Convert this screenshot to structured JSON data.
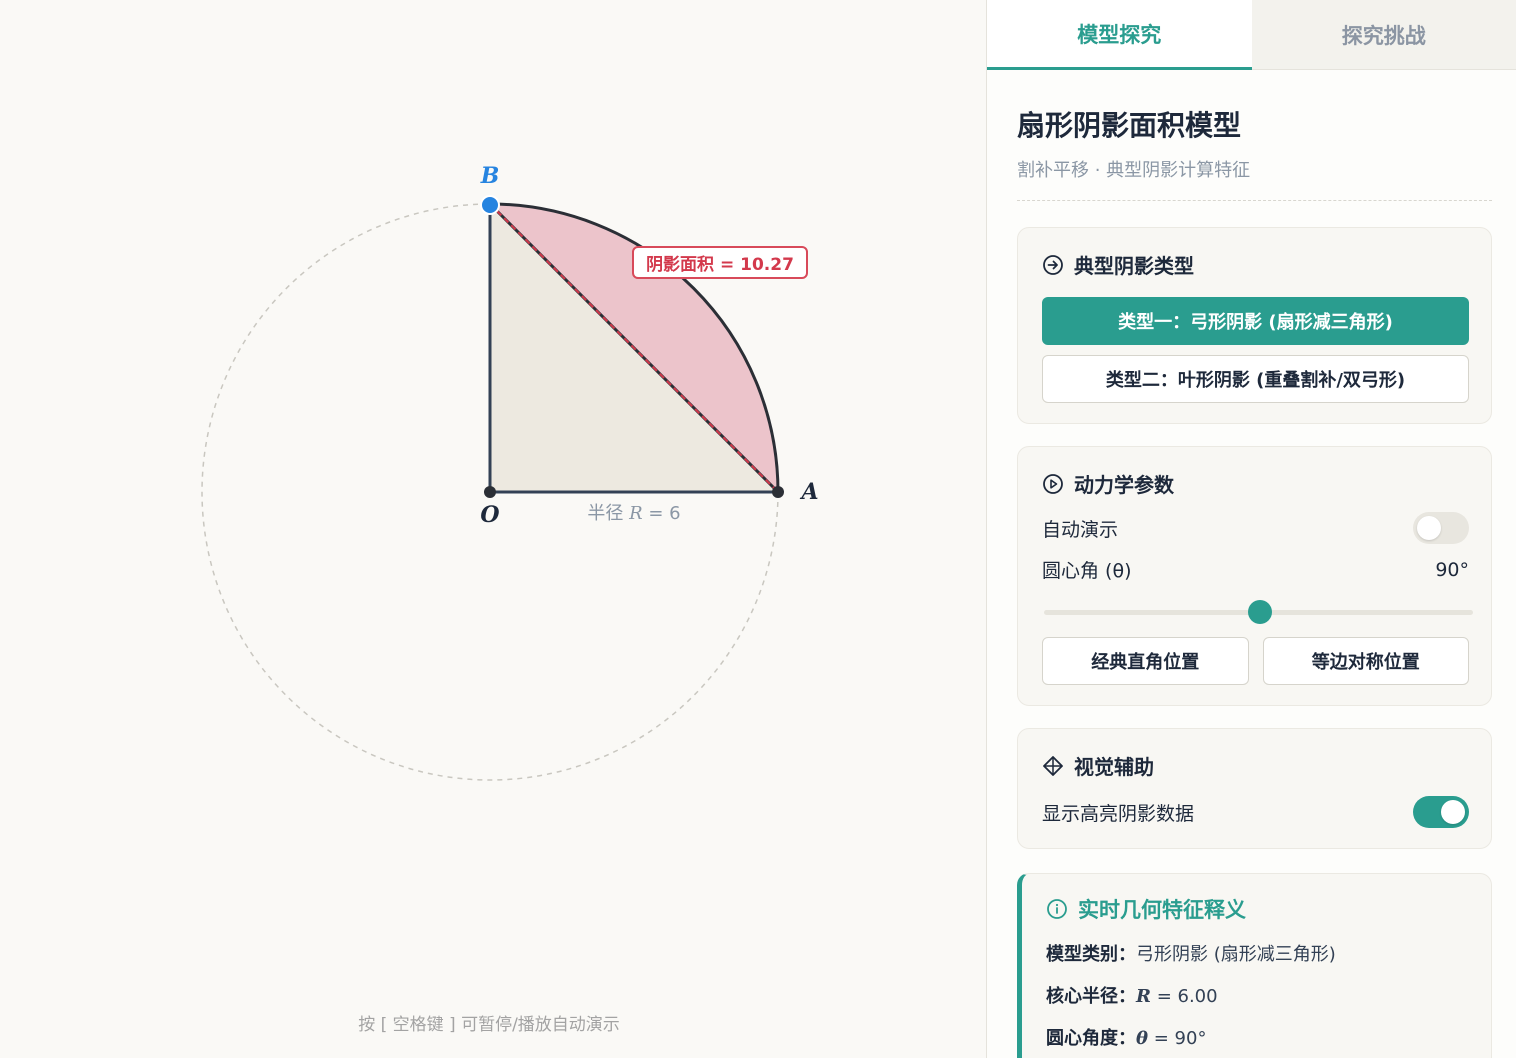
{
  "canvas": {
    "label_B": "B",
    "label_A": "A",
    "label_O": "O",
    "radius_label_prefix": "半径 ",
    "radius_label_var": "R",
    "radius_label_suffix": " = 6",
    "shaded_area_label": "阴影面积 = 10.27",
    "hint": "按 [ 空格键 ] 可暂停/播放自动演示",
    "colors": {
      "shade": "#ecc4cb",
      "sector": "#ede9e0",
      "point_B": "#2684e0",
      "chord": "#d3394c"
    }
  },
  "tabs": [
    {
      "label": "模型探究",
      "active": true
    },
    {
      "label": "探究挑战",
      "active": false
    }
  ],
  "panel": {
    "title": "扇形阴影面积模型",
    "subtitle": "割补平移 · 典型阴影计算特征"
  },
  "types_card": {
    "heading": "典型阴影类型",
    "icon": "arrow-circle-icon",
    "type1": "类型一：弓形阴影 (扇形减三角形)",
    "type2": "类型二：叶形阴影 (重叠割补/双弓形)"
  },
  "dynamics_card": {
    "heading": "动力学参数",
    "icon": "play-circle-icon",
    "auto_demo_label": "自动演示",
    "auto_demo_on": false,
    "angle_label": "圆心角 (θ)",
    "angle_value": "90°",
    "angle_slider_fraction": 0.5,
    "btn_classic": "经典直角位置",
    "btn_symmetric": "等边对称位置"
  },
  "visual_card": {
    "heading": "视觉辅助",
    "icon": "crosshair-diamond-icon",
    "highlight_label": "显示高亮阴影数据",
    "highlight_on": true
  },
  "info_card": {
    "heading": "实时几何特征释义",
    "icon": "info-circle-icon",
    "model_type_key": "模型类别：",
    "model_type_val": "弓形阴影 (扇形减三角形)",
    "radius_key": "核心半径：",
    "radius_var": "R",
    "radius_val": " = 6.00",
    "angle_key": "圆心角度：",
    "angle_var": "θ",
    "angle_val": " = 90°"
  }
}
